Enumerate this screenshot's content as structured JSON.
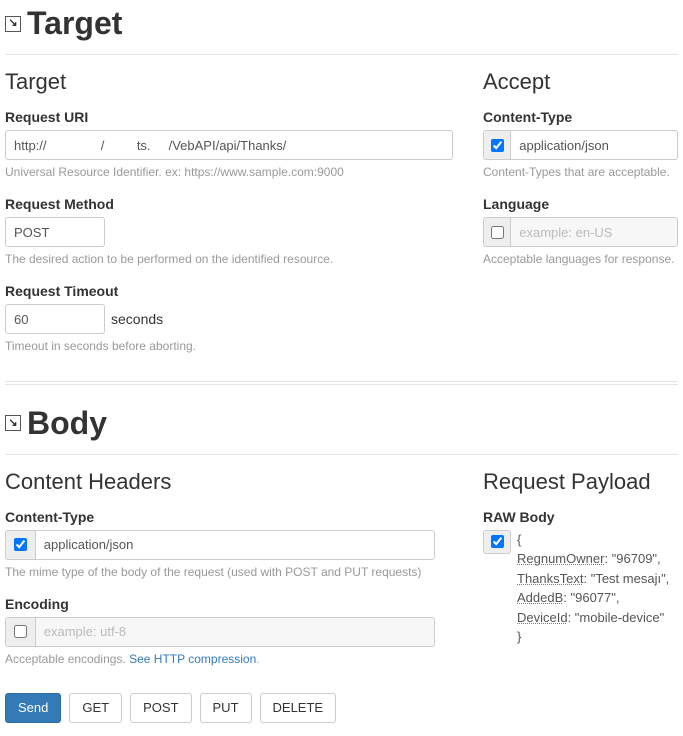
{
  "sections": {
    "target": {
      "title": "Target",
      "left": {
        "heading": "Target",
        "uri": {
          "label": "Request URI",
          "value": "http://               /         ts.     /VebAPI/api/Thanks/",
          "help": "Universal Resource Identifier. ex: https://www.sample.com:9000"
        },
        "method": {
          "label": "Request Method",
          "value": "POST",
          "help": "The desired action to be performed on the identified resource."
        },
        "timeout": {
          "label": "Request Timeout",
          "value": "60",
          "unit": "seconds",
          "help": "Timeout in seconds before aborting."
        }
      },
      "right": {
        "heading": "Accept",
        "contentType": {
          "label": "Content-Type",
          "value": "application/json",
          "checked": true,
          "help": "Content-Types that are acceptable."
        },
        "language": {
          "label": "Language",
          "placeholder": "example: en-US",
          "checked": false,
          "help": "Acceptable languages for response."
        }
      }
    },
    "body": {
      "title": "Body",
      "left": {
        "heading": "Content Headers",
        "contentType": {
          "label": "Content-Type",
          "value": "application/json",
          "checked": true,
          "help": "The mime type of the body of the request (used with POST and PUT requests)"
        },
        "encoding": {
          "label": "Encoding",
          "placeholder": "example: utf-8",
          "checked": false,
          "helpPrefix": "Acceptable encodings. ",
          "helpLink": "See HTTP compression"
        }
      },
      "right": {
        "heading": "Request Payload",
        "rawBody": {
          "label": "RAW Body",
          "checked": true,
          "lines": [
            {
              "open": "{"
            },
            {
              "k": "RegnumOwner",
              "v": ": \"96709\","
            },
            {
              "k": "ThanksText",
              "v": ": \"Test mesajı\","
            },
            {
              "k": "AddedB",
              "v": ": \"96077\","
            },
            {
              "k": "DeviceId",
              "v": ": \"mobile-device\""
            },
            {
              "close": "}"
            }
          ]
        }
      }
    }
  },
  "buttons": {
    "send": "Send",
    "get": "GET",
    "post": "POST",
    "put": "PUT",
    "delete": "DELETE"
  },
  "helpLinkPeriod": "."
}
